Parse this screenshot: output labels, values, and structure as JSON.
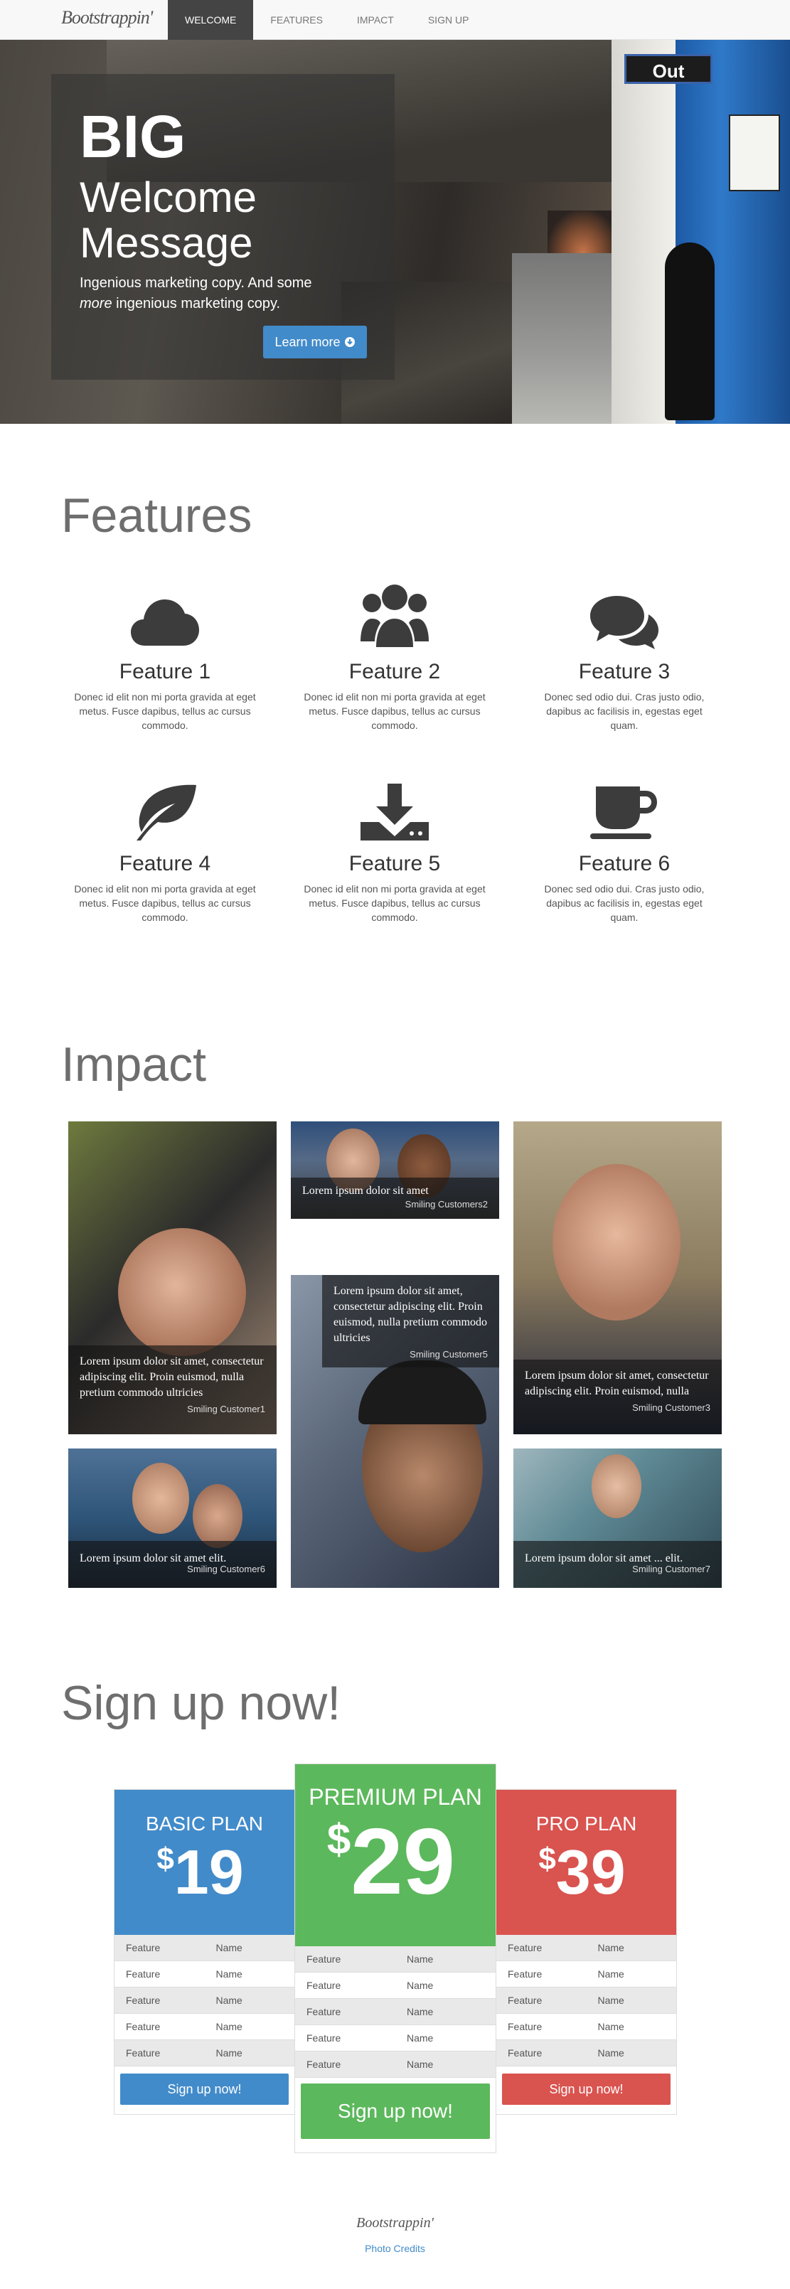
{
  "nav": {
    "brand": "Bootstrappin'",
    "items": [
      "WELCOME",
      "FEATURES",
      "IMPACT",
      "SIGN UP"
    ]
  },
  "hero": {
    "sign": "Out",
    "big": "BIG",
    "welcome": "Welcome Message",
    "tagline_a": "Ingenious marketing copy. And some",
    "tagline_em": "more",
    "tagline_b": "ingenious marketing copy.",
    "button": "Learn more"
  },
  "features": {
    "title": "Features",
    "items": [
      {
        "name": "Feature 1",
        "text": "Donec id elit non mi porta gravida at eget metus. Fusce dapibus, tellus ac cursus commodo."
      },
      {
        "name": "Feature 2",
        "text": "Donec id elit non mi porta gravida at eget metus. Fusce dapibus, tellus ac cursus commodo."
      },
      {
        "name": "Feature 3",
        "text": "Donec sed odio dui. Cras justo odio, dapibus ac facilisis in, egestas eget quam."
      },
      {
        "name": "Feature 4",
        "text": "Donec id elit non mi porta gravida at eget metus. Fusce dapibus, tellus ac cursus commodo."
      },
      {
        "name": "Feature 5",
        "text": "Donec id elit non mi porta gravida at eget metus. Fusce dapibus, tellus ac cursus commodo."
      },
      {
        "name": "Feature 6",
        "text": "Donec sed odio dui. Cras justo odio, dapibus ac facilisis in, egestas eget quam."
      }
    ],
    "icons": [
      "cloud-icon",
      "users-icon",
      "chat-icon",
      "leaf-icon",
      "download-icon",
      "coffee-icon"
    ]
  },
  "impact": {
    "title": "Impact",
    "tiles": [
      {
        "text": "Lorem ipsum dolor sit amet, consectetur adipiscing elit. Proin euismod, nulla pretium commodo ultricies",
        "caption": "Smiling Customer1"
      },
      {
        "text": "Lorem ipsum dolor sit amet",
        "caption": "Smiling Customers2"
      },
      {
        "text": "Lorem ipsum dolor sit amet, consectetur adipiscing elit. Proin euismod, nulla",
        "caption": "Smiling Customer3"
      },
      {
        "text": "Lorem ipsum dolor sit amet, consectetur adipiscing elit. Proin euismod, nulla pretium commodo ultricies",
        "caption": "Smiling Customer5"
      },
      {
        "text": "Lorem ipsum dolor sit amet elit.",
        "caption": "Smiling Customer6"
      },
      {
        "text": "Lorem ipsum dolor sit amet ... elit.",
        "caption": "Smiling Customer7"
      }
    ]
  },
  "signup": {
    "title": "Sign up now!",
    "plans": [
      {
        "name": "BASIC PLAN",
        "currency": "$",
        "price": "19",
        "color": "#428bca",
        "button": "Sign up now!"
      },
      {
        "name": "PREMIUM PLAN",
        "currency": "$",
        "price": "29",
        "color": "#5cb85c",
        "button": "Sign up now!"
      },
      {
        "name": "PRO PLAN",
        "currency": "$",
        "price": "39",
        "color": "#d9534f",
        "button": "Sign up now!"
      }
    ],
    "row_feature": "Feature",
    "row_name": "Name"
  },
  "footer": {
    "brand": "Bootstrappin'",
    "link": "Photo Credits"
  }
}
